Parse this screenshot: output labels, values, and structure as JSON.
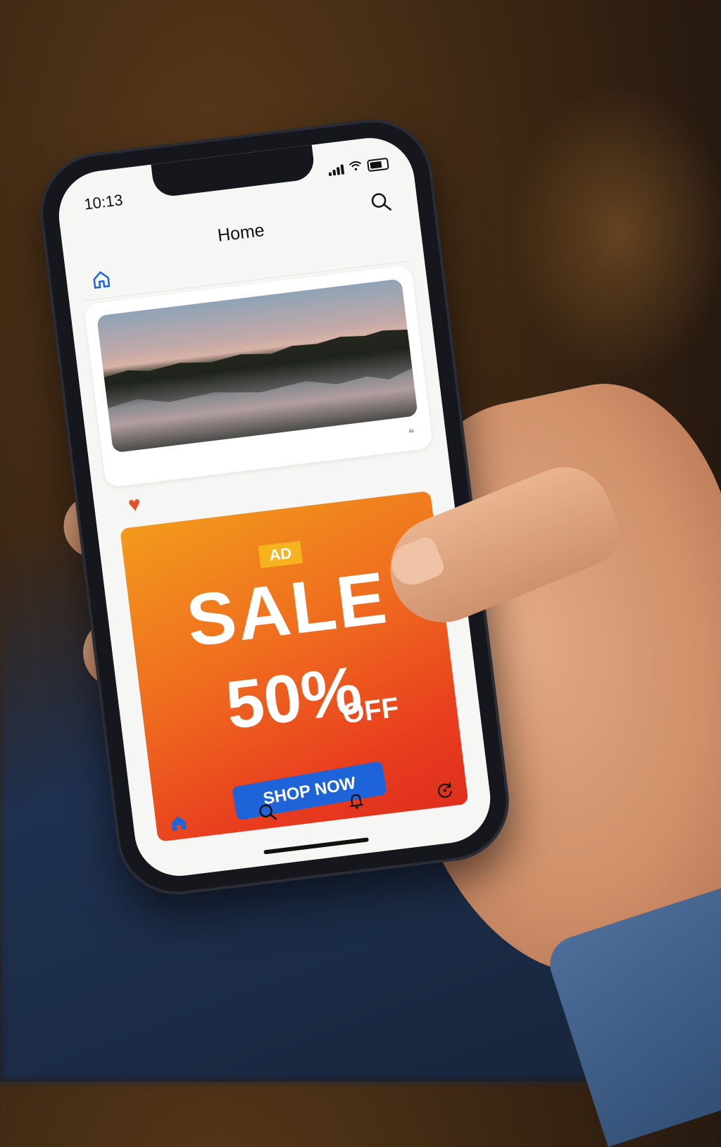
{
  "status": {
    "time": "10:13"
  },
  "header": {
    "title": "Home",
    "search_icon": "search-icon",
    "home_icon": "home-icon"
  },
  "feed": {
    "photo": "lake-sunset-photo",
    "more_icon": "quote-icon",
    "like_icon": "heart-icon"
  },
  "ad": {
    "badge": "AD",
    "headline": "SALE",
    "discount": "50%",
    "suffix": "OFF",
    "cta": "SHOP NOW",
    "colors": {
      "start": "#f29a1c",
      "end": "#df2f1d",
      "cta": "#1e63d8",
      "badge": "#f6b31d"
    }
  },
  "tabbar": {
    "items": [
      {
        "icon": "home-icon",
        "active": true
      },
      {
        "icon": "search-icon",
        "active": false
      },
      {
        "icon": "bell-icon",
        "active": false
      },
      {
        "icon": "refresh-icon",
        "active": false
      }
    ],
    "accent": "#1e63d8"
  }
}
